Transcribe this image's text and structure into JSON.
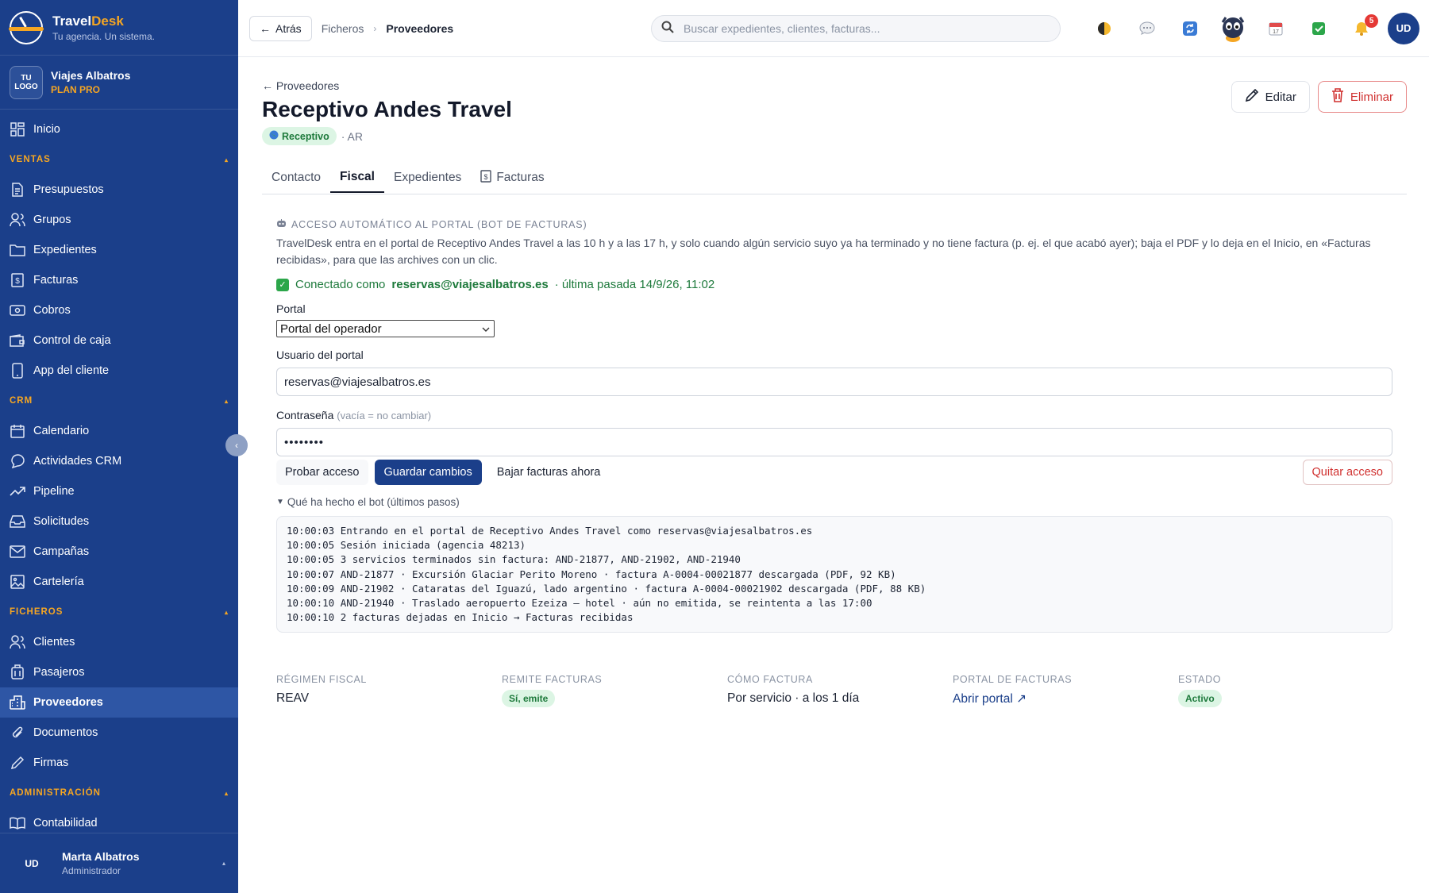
{
  "brand": {
    "name_a": "Travel",
    "name_b": "Desk",
    "tagline": "Tu agencia. Un sistema."
  },
  "agency": {
    "logo_text": "TU LOGO",
    "name": "Viajes Albatros",
    "plan": "PLAN PRO"
  },
  "sidebar": {
    "inicio": "Inicio",
    "sections": [
      {
        "title": "VENTAS",
        "items": [
          "Presupuestos",
          "Grupos",
          "Expedientes",
          "Facturas",
          "Cobros",
          "Control de caja",
          "App del cliente"
        ]
      },
      {
        "title": "CRM",
        "items": [
          "Calendario",
          "Actividades CRM",
          "Pipeline",
          "Solicitudes",
          "Campañas",
          "Cartelería"
        ]
      },
      {
        "title": "FICHEROS",
        "items": [
          "Clientes",
          "Pasajeros",
          "Proveedores",
          "Documentos",
          "Firmas"
        ]
      },
      {
        "title": "ADMINISTRACIÓN",
        "items": [
          "Contabilidad"
        ]
      }
    ],
    "active_item": "Proveedores",
    "user": {
      "initials": "UD",
      "name": "Marta Albatros",
      "role": "Administrador"
    }
  },
  "topbar": {
    "back_label": "Atrás",
    "breadcrumb": [
      "Ficheros",
      "Proveedores"
    ],
    "search_placeholder": "Buscar expedientes, clientes, facturas...",
    "notifications_count": "5",
    "avatar_initials": "UD"
  },
  "page": {
    "back_link": "Proveedores",
    "title": "Receptivo Andes Travel",
    "type_badge": "Receptivo",
    "country": "· AR",
    "edit_label": "Editar",
    "delete_label": "Eliminar",
    "tabs": [
      "Contacto",
      "Fiscal",
      "Expedientes",
      "Facturas"
    ],
    "active_tab": "Fiscal"
  },
  "portal": {
    "title": "ACCESO AUTOMÁTICO AL PORTAL (BOT DE FACTURAS)",
    "description": "TravelDesk entra en el portal de Receptivo Andes Travel a las 10 h y a las 17 h, y solo cuando algún servicio suyo ya ha terminado y no tiene factura (p. ej. el que acabó ayer); baja el PDF y lo deja en el Inicio, en «Facturas recibidas», para que las archives con un clic.",
    "connected_prefix": "Conectado como",
    "connected_user": "reservas@viajesalbatros.es",
    "connected_suffix": "· última pasada 14/9/26, 11:02",
    "portal_label": "Portal",
    "portal_value": "Portal del operador",
    "user_label": "Usuario del portal",
    "user_value": "reservas@viajesalbatros.es",
    "password_label": "Contraseña",
    "password_hint": "(vacía = no cambiar)",
    "password_value": "••••••••",
    "btn_test": "Probar acceso",
    "btn_save": "Guardar cambios",
    "btn_fetch": "Bajar facturas ahora",
    "btn_remove": "Quitar acceso",
    "log_toggle": "Qué ha hecho el bot (últimos pasos)",
    "log": [
      "10:00:03 Entrando en el portal de Receptivo Andes Travel como reservas@viajesalbatros.es",
      "10:00:05 Sesión iniciada (agencia 48213)",
      "10:00:05 3 servicios terminados sin factura: AND-21877, AND-21902, AND-21940",
      "10:00:07 AND-21877 · Excursión Glaciar Perito Moreno · factura A-0004-00021877 descargada (PDF, 92 KB)",
      "10:00:09 AND-21902 · Cataratas del Iguazú, lado argentino · factura A-0004-00021902 descargada (PDF, 88 KB)",
      "10:00:10 AND-21940 · Traslado aeropuerto Ezeiza — hotel · aún no emitida, se reintenta a las 17:00",
      "10:00:10 2 facturas dejadas en Inicio → Facturas recibidas"
    ]
  },
  "summary": {
    "regimen_label": "RÉGIMEN FISCAL",
    "regimen_value": "REAV",
    "remite_label": "REMITE FACTURAS",
    "remite_value": "Sí, emite",
    "como_label": "CÓMO FACTURA",
    "como_value": "Por servicio · a los 1 día",
    "portal_label": "PORTAL DE FACTURAS",
    "portal_value": "Abrir portal ↗",
    "estado_label": "ESTADO",
    "estado_value": "Activo"
  }
}
